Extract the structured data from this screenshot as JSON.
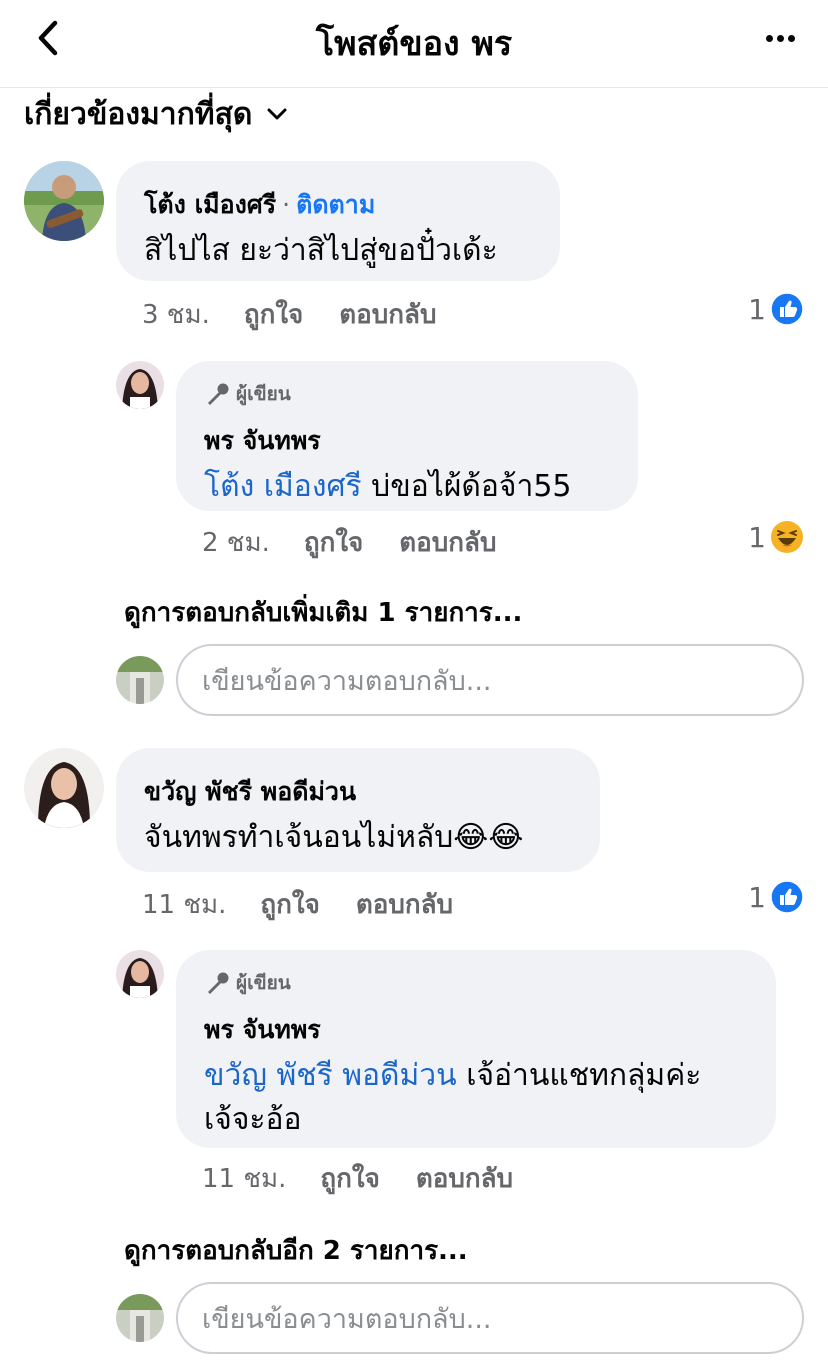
{
  "header": {
    "title": "โพสต์ของ พร"
  },
  "sort": {
    "label": "เกี่ยวข้องมากที่สุด"
  },
  "comments": [
    {
      "name": "โต้ง เมืองศรี",
      "follow": "ติดตาม",
      "text": "สิไปไส ยะว่าสิไปสู่ขอปั๋วเด้ะ",
      "time": "3 ชม.",
      "like": "ถูกใจ",
      "reply": "ตอบกลับ",
      "reaction_count": "1",
      "reaction": "like",
      "replies": [
        {
          "author_tag": "ผู้เขียน",
          "name": "พร จันทพร",
          "mention": "โต้ง เมืองศรี",
          "text": " บ่ขอไผ้ด้อจ้า55",
          "time": "2 ชม.",
          "like": "ถูกใจ",
          "reply": "ตอบกลับ",
          "reaction_count": "1",
          "reaction": "haha"
        }
      ],
      "more_replies": "ดูการตอบกลับเพิ่มเติม 1 รายการ...",
      "reply_placeholder": "เขียนข้อความตอบกลับ..."
    },
    {
      "name": "ขวัญ พัชรี พอดีม่วน",
      "text": "จันทพรทำเจ้นอนไม่หลับ😂😂",
      "time": "11 ชม.",
      "like": "ถูกใจ",
      "reply": "ตอบกลับ",
      "reaction_count": "1",
      "reaction": "like",
      "replies": [
        {
          "author_tag": "ผู้เขียน",
          "name": "พร จันทพร",
          "mention": "ขวัญ พัชรี พอดีม่วน",
          "text": " เจ้อ่านแชทกลุ่มค่ะ",
          "text2": "เจ้จะอ้อ",
          "time": "11 ชม.",
          "like": "ถูกใจ",
          "reply": "ตอบกลับ"
        }
      ],
      "more_replies": "ดูการตอบกลับอีก 2 รายการ...",
      "reply_placeholder": "เขียนข้อความตอบกลับ..."
    }
  ],
  "colors": {
    "accent": "#1877f2",
    "mention": "#1b66c9",
    "bubble": "#f0f2f5",
    "haha": "#f7b125"
  }
}
